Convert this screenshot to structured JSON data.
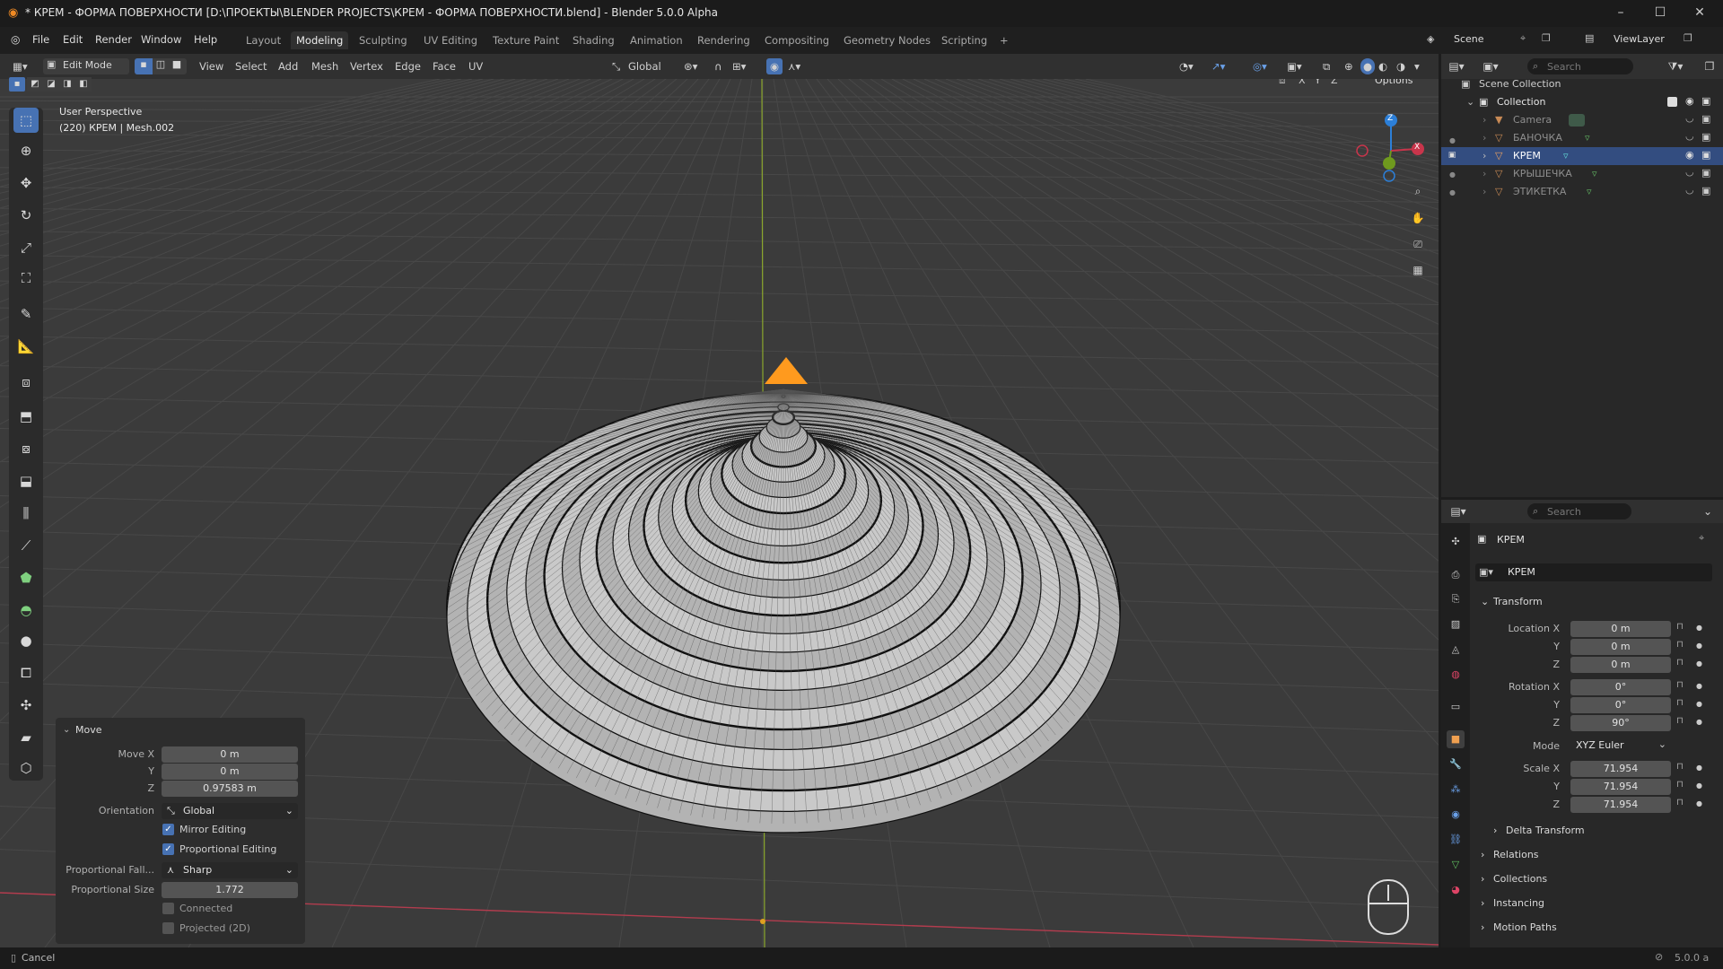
{
  "titlebar": {
    "title": "* КРЕМ - ФОРМА ПОВЕРХНОСТИ [D:\\ПРОЕКТЫ\\BLENDER PROJECTS\\КРЕМ - ФОРМА ПОВЕРХНОСТИ.blend] - Blender 5.0.0 Alpha"
  },
  "menubar": {
    "items": [
      "File",
      "Edit",
      "Render",
      "Window",
      "Help"
    ],
    "workspaces": [
      "Layout",
      "Modeling",
      "Sculpting",
      "UV Editing",
      "Texture Paint",
      "Shading",
      "Animation",
      "Rendering",
      "Compositing",
      "Geometry Nodes",
      "Scripting"
    ],
    "active_workspace": "Modeling",
    "scene": "Scene",
    "view_layer": "ViewLayer"
  },
  "viewport_header": {
    "mode": "Edit Mode",
    "menus": [
      "View",
      "Select",
      "Add",
      "Mesh",
      "Vertex",
      "Edge",
      "Face",
      "UV"
    ],
    "orientation": "Global",
    "options": "Options",
    "axes": [
      "X",
      "Y",
      "Z"
    ]
  },
  "viewport": {
    "perspective": "User Perspective",
    "object_info": "(220) КРЕМ | Mesh.002",
    "gizmo_axes": [
      "Z",
      "X"
    ]
  },
  "move_panel": {
    "title": "Move",
    "move_x_label": "Move X",
    "move_x": "0 m",
    "y_label": "Y",
    "move_y": "0 m",
    "z_label": "Z",
    "move_z": "0.97583 m",
    "orientation_label": "Orientation",
    "orientation": "Global",
    "mirror_editing": "Mirror Editing",
    "proportional_editing": "Proportional Editing",
    "falloff_label": "Proportional Fall...",
    "falloff": "Sharp",
    "size_label": "Proportional Size",
    "size": "1.772",
    "connected": "Connected",
    "projected": "Projected (2D)"
  },
  "outliner": {
    "search_placeholder": "Search",
    "scene_collection": "Scene Collection",
    "collection": "Collection",
    "items": [
      "Camera",
      "БАНОЧКА",
      "КРЕМ",
      "КРЫШЕЧКА",
      "ЭТИКЕТКА"
    ],
    "selected": "КРЕМ"
  },
  "properties": {
    "search_placeholder": "Search",
    "object_name": "КРЕМ",
    "object_field": "КРЕМ",
    "transform": "Transform",
    "location_x_label": "Location X",
    "location_x": "0 m",
    "location_y": "0 m",
    "location_z": "0 m",
    "rotation_x_label": "Rotation X",
    "rotation_x": "0°",
    "rotation_y": "0°",
    "rotation_z": "90°",
    "mode_label": "Mode",
    "mode": "XYZ Euler",
    "scale_x_label": "Scale X",
    "scale_x": "71.954",
    "scale_y": "71.954",
    "scale_z": "71.954",
    "y_label": "Y",
    "z_label": "Z",
    "delta_transform": "Delta Transform",
    "sections": [
      "Relations",
      "Collections",
      "Instancing",
      "Motion Paths"
    ]
  },
  "statusbar": {
    "left": "Cancel",
    "version": "5.0.0 a"
  },
  "colors": {
    "accent": "#4772b3",
    "selected_vertex": "#ff9a1e",
    "axis_x": "#c8354b",
    "axis_y": "#6f9a1e",
    "axis_z": "#2c7fd8"
  }
}
